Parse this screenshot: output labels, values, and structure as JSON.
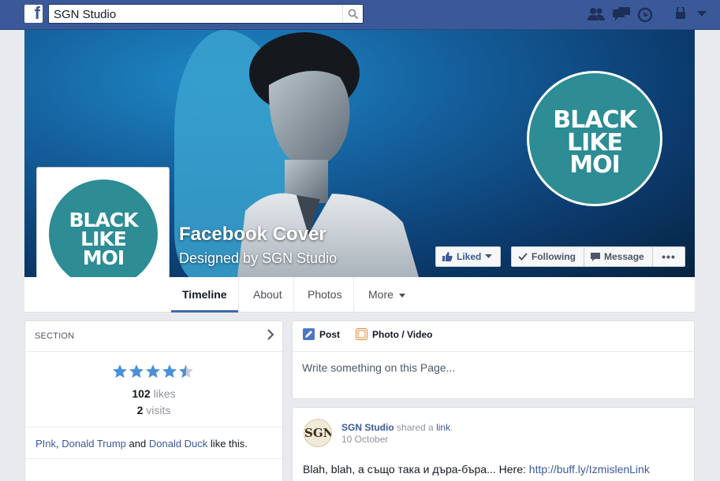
{
  "search": {
    "value": "SGN Studio"
  },
  "cover": {
    "title": "Facebook Cover",
    "subtitle": "Designed by SGN Studio",
    "logo_lines": [
      "BLACK",
      "LIKE",
      "MOI"
    ]
  },
  "actions": {
    "liked": "Liked",
    "following": "Following",
    "message": "Message",
    "more": "•••"
  },
  "tabs": [
    "Timeline",
    "About",
    "Photos",
    "More"
  ],
  "section": {
    "header": "SECTION",
    "rating": 4.5,
    "likes_count": "102",
    "likes_label": "likes",
    "visits_count": "2",
    "visits_label": "visits",
    "friend1": "PInk",
    "friend2": "Donald Trump",
    "and": "and",
    "friend3": "Donald Duck",
    "like_this": "like this."
  },
  "composer": {
    "post_tab": "Post",
    "photo_tab": "Photo / Video",
    "placeholder": "Write something on this Page..."
  },
  "post": {
    "author": "SGN Studio",
    "action": "shared a",
    "action_link": "link",
    "date": "10 October",
    "avatar_text": "SGN",
    "body_text": "Blah, blah, а също така и дъра-бъра... Here:",
    "body_link": "http://buff.ly/IzmislenLink"
  },
  "colors": {
    "topbar": "#3b5998",
    "badge": "#2d8c94",
    "link": "#3b5998",
    "star": "#4a90d9"
  }
}
